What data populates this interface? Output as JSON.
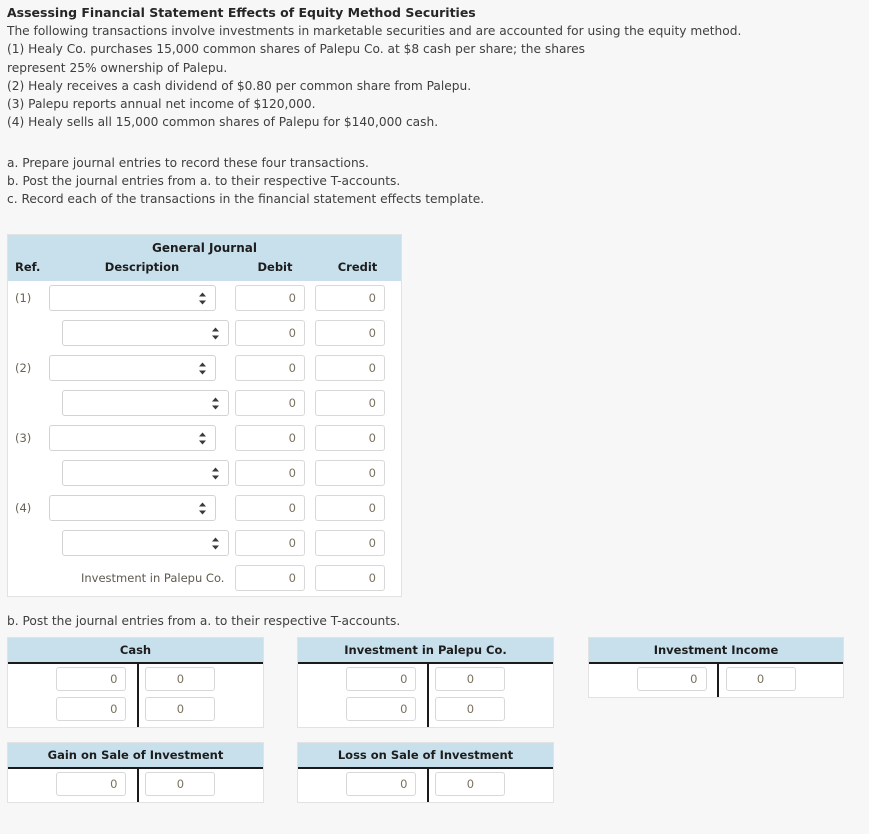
{
  "problem": {
    "title": "Assessing Financial Statement Effects of Equity Method Securities",
    "intro_lines": [
      "The following transactions involve investments in marketable securities and are accounted for using the equity method.",
      "(1) Healy Co. purchases 15,000 common shares of Palepu Co. at $8 cash per share; the shares",
      "represent 25% ownership of Palepu.",
      "(2) Healy receives a cash dividend of $0.80 per common share from Palepu.",
      "(3) Palepu reports annual net income of $120,000.",
      "(4) Healy sells all 15,000 common shares of Palepu for $140,000 cash."
    ],
    "requirements": [
      "a. Prepare journal entries to record these four transactions.",
      "b. Post the journal entries from a. to their respective T-accounts.",
      "c. Record each of the transactions in the financial statement effects template."
    ]
  },
  "journal": {
    "table_title": "General Journal",
    "columns": {
      "ref": "Ref.",
      "description": "Description",
      "debit": "Debit",
      "credit": "Credit"
    },
    "select_placeholder": "",
    "rows": [
      {
        "ref": "(1)",
        "type": "select",
        "indent": false,
        "description": "",
        "debit": "0",
        "credit": "0"
      },
      {
        "ref": "",
        "type": "select",
        "indent": true,
        "description": "",
        "debit": "0",
        "credit": "0"
      },
      {
        "ref": "(2)",
        "type": "select",
        "indent": false,
        "description": "",
        "debit": "0",
        "credit": "0"
      },
      {
        "ref": "",
        "type": "select",
        "indent": true,
        "description": "",
        "debit": "0",
        "credit": "0"
      },
      {
        "ref": "(3)",
        "type": "select",
        "indent": false,
        "description": "",
        "debit": "0",
        "credit": "0"
      },
      {
        "ref": "",
        "type": "select",
        "indent": true,
        "description": "",
        "debit": "0",
        "credit": "0"
      },
      {
        "ref": "(4)",
        "type": "select",
        "indent": false,
        "description": "",
        "debit": "0",
        "credit": "0"
      },
      {
        "ref": "",
        "type": "select",
        "indent": true,
        "description": "",
        "debit": "0",
        "credit": "0"
      },
      {
        "ref": "",
        "type": "text",
        "indent": true,
        "description": "Investment in Palepu Co.",
        "debit": "0",
        "credit": "0"
      }
    ]
  },
  "t_accounts": {
    "section_label": "b. Post the journal entries from a. to their respective T-accounts.",
    "accounts": [
      {
        "name": "Cash",
        "rows": [
          {
            "debit": "0",
            "credit": "0"
          },
          {
            "debit": "0",
            "credit": "0"
          }
        ]
      },
      {
        "name": "Investment in Palepu Co.",
        "rows": [
          {
            "debit": "0",
            "credit": "0"
          },
          {
            "debit": "0",
            "credit": "0"
          }
        ]
      },
      {
        "name": "Investment Income",
        "rows": [
          {
            "debit": "0",
            "credit": "0"
          }
        ]
      },
      {
        "name": "Gain on Sale of Investment",
        "rows": [
          {
            "debit": "0",
            "credit": "0"
          }
        ]
      },
      {
        "name": "Loss on Sale of Investment",
        "rows": [
          {
            "debit": "0",
            "credit": "0"
          }
        ]
      }
    ]
  },
  "colors": {
    "header_blue": "#c7e0ec",
    "page_background": "#f7f7f7",
    "text": "#3f3f3f",
    "divider": "#1a1a1a"
  }
}
